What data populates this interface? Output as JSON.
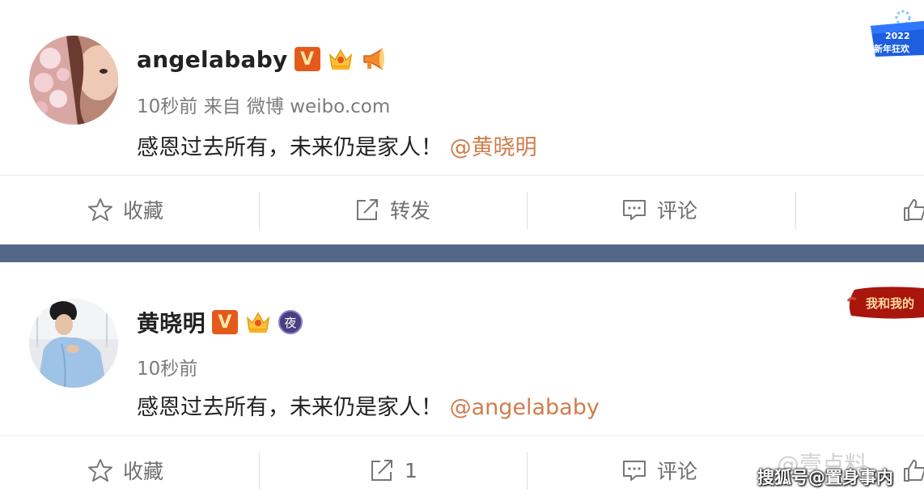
{
  "posts": [
    {
      "username": "angelababy",
      "badges": [
        "verified-v-badge",
        "crown-badge",
        "megaphone-badge"
      ],
      "verified_letter": "V",
      "meta": "10秒前 来自 微博 weibo.com",
      "text": "感恩过去所有，未来仍是家人！",
      "mention": "@黄晓明",
      "actions": {
        "favorite": "收藏",
        "repost": "转发",
        "comment": "评论"
      }
    },
    {
      "username": "黄晓明",
      "badges": [
        "verified-v-badge",
        "crown-badge",
        "night-badge"
      ],
      "verified_letter": "V",
      "night_glyph": "夜",
      "meta": "10秒前",
      "text": "感恩过去所有，未来仍是家人！",
      "mention": "@angelababy",
      "actions": {
        "favorite": "收藏",
        "repost": "1",
        "comment": "评论"
      }
    }
  ],
  "decorations": {
    "event_badge_text": "2022",
    "event_badge_sub": "新年狂欢",
    "red_badge_text": "我和我的"
  },
  "watermarks": {
    "faint": "@壹点料",
    "main": "搜狐号@置身事内"
  },
  "colors": {
    "mention": "#d07d4d",
    "divider_band": "#546787",
    "verified_badge": "#e35a1b",
    "night_badge": "#4a3f7c"
  }
}
